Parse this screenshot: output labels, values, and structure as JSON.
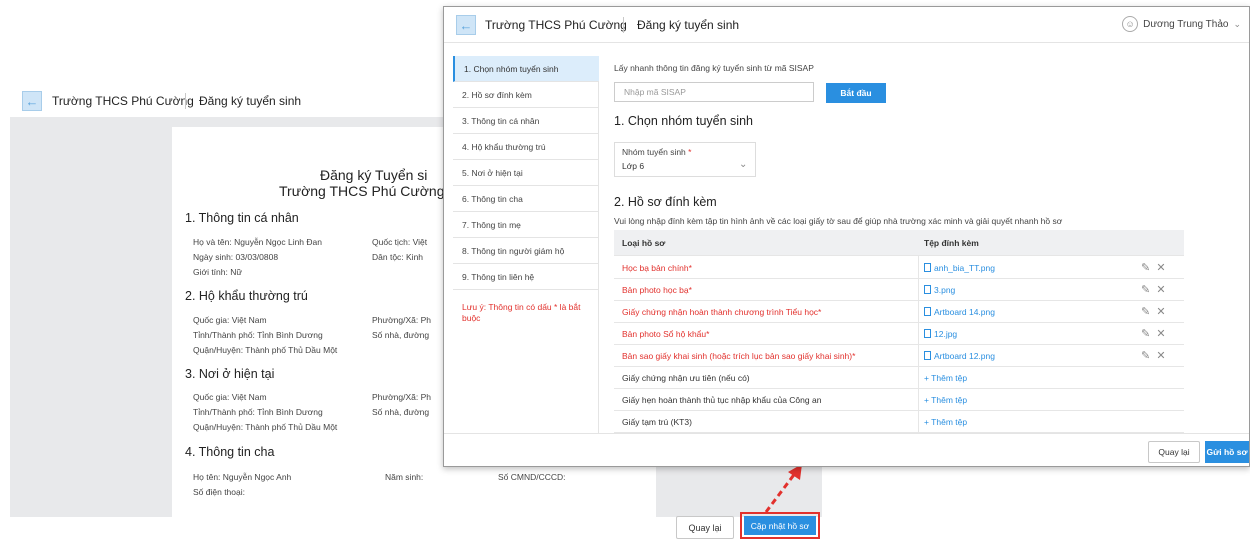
{
  "app": {
    "school": "Trường THCS Phú Cường",
    "page": "Đăng ký tuyển sinh"
  },
  "background": {
    "doc_title_1": "Đăng ký Tuyển si",
    "doc_title_2": "Trường THCS Phú Cường nă",
    "sections": {
      "s1": "1. Thông tin cá nhân",
      "s2": "2. Hộ khẩu thường trú",
      "s3": "3. Nơi ở hiện tại",
      "s4": "4. Thông tin cha"
    },
    "fields": {
      "hoten": "Họ và tên: Nguyễn Ngọc Linh Đan",
      "quoctich": "Quốc tịch: Việt",
      "ngaysinh": "Ngày sinh: 03/03/0808",
      "dantoc": "Dân tộc: Kinh",
      "gioitinh": "Giới tính: Nữ",
      "qg1": "Quốc gia: Việt Nam",
      "px1": "Phường/Xã: Ph",
      "tinh1": "Tỉnh/Thành phố: Tỉnh Bình Dương",
      "sonha1": "Số nhà, đường",
      "qh1": "Quận/Huyện: Thành phố Thủ Dầu Một",
      "qg2": "Quốc gia: Việt Nam",
      "px2": "Phường/Xã: Ph",
      "tinh2": "Tỉnh/Thành phố: Tỉnh Bình Dương",
      "sonha2": "Số nhà, đường",
      "qh2": "Quận/Huyện: Thành phố Thủ Dầu Một",
      "hoten_cha": "Họ tên: Nguyễn Ngọc Anh",
      "namsinh": "Năm sinh:",
      "cmnd": "Số CMND/CCCD:",
      "sdt": "Số điện thoại:"
    },
    "btn_back": "Quay lại",
    "btn_update": "Cập nhật hồ sơ"
  },
  "modal": {
    "user_name": "Dương Trung Thảo",
    "sidebar": [
      "1. Chọn nhóm tuyển sinh",
      "2. Hồ sơ đính kèm",
      "3. Thông tin cá nhân",
      "4. Hộ khẩu thường trú",
      "5. Nơi ở hiện tại",
      "6. Thông tin cha",
      "7. Thông tin mẹ",
      "8. Thông tin người giám hộ",
      "9. Thông tin liên hệ"
    ],
    "sidebar_note": "Lưu ý: Thông tin có dấu * là bắt buộc",
    "sisap_hint": "Lấy nhanh thông tin đăng ký tuyển sinh từ mã SISAP",
    "sisap_placeholder": "Nhập mã SISAP",
    "btn_start": "Bắt đầu",
    "sec1_title": "1. Chọn nhóm tuyển sinh",
    "group_label": "Nhóm tuyển sinh",
    "group_req": "*",
    "group_value": "Lớp 6",
    "sec2_title": "2. Hồ sơ đính kèm",
    "sec2_desc": "Vui lòng nhập đính kèm tập tin hình ảnh về các loại giấy tờ sau để giúp nhà trường xác minh và giải quyết nhanh hồ sơ",
    "table_headers": [
      "Loại hồ sơ",
      "Tệp đính kèm"
    ],
    "table_rows": [
      {
        "type": "Học bạ bản chính*",
        "file": "anh_bia_TT.png"
      },
      {
        "type": "Bản photo học bạ*",
        "file": "3.png"
      },
      {
        "type": "Giấy chứng nhận hoàn thành chương trình Tiểu học*",
        "file": "Artboard 14.png"
      },
      {
        "type": "Bản photo Sổ hộ khẩu*",
        "file": "12.jpg"
      },
      {
        "type": "Bản sao giấy khai sinh (hoặc trích lục bản sao giấy khai sinh)*",
        "file": "Artboard 12.png"
      },
      {
        "type": "Giấy chứng nhận ưu tiên (nếu có)",
        "file": "+ Thêm tệp"
      },
      {
        "type": "Giấy hẹn hoàn thành thủ tục nhập khẩu của Công an",
        "file": "+ Thêm tệp"
      },
      {
        "type": "Giấy tạm trú (KT3)",
        "file": "+ Thêm tệp"
      }
    ],
    "btn_back": "Quay lại",
    "btn_submit": "Gửi hồ sơ"
  },
  "colors": {
    "accent": "#2a8fe0",
    "required": "#e2312d",
    "highlight": "#e2312d"
  }
}
